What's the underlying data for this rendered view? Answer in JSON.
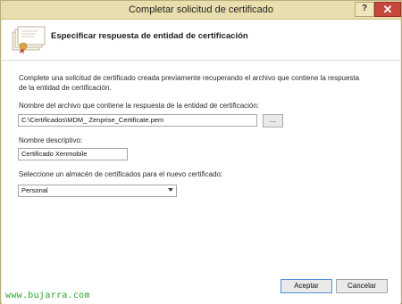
{
  "window": {
    "title": "Completar solicitud de certificado",
    "help_label": "?",
    "close_label": "✕"
  },
  "header": {
    "title": "Especificar respuesta de entidad de certificación",
    "icon": "certificate-icon"
  },
  "body": {
    "intro_line1": "Complete una solicitud de certificado creada previamente recuperando el archivo que contiene la respuesta",
    "intro_line2": "de la entidad de certificación.",
    "file_label": "Nombre del archivo que contiene la respuesta de la entidad de certificación:",
    "file_value": "C:\\Certificados\\MDM_ Zenprise_Certificate.pem",
    "browse_label": "...",
    "friendly_label": "Nombre descriptivo:",
    "friendly_value": "Certificado Xenmobile",
    "store_label": "Seleccione un almacén de certificados para el nuevo certificado:",
    "store_value": "Personal"
  },
  "buttons": {
    "accept": "Aceptar",
    "cancel": "Cancelar"
  },
  "watermark": "www.bujarra.com",
  "colors": {
    "titlebar": "#e9dfae",
    "close": "#c7473d",
    "accent": "#4f90d9"
  }
}
